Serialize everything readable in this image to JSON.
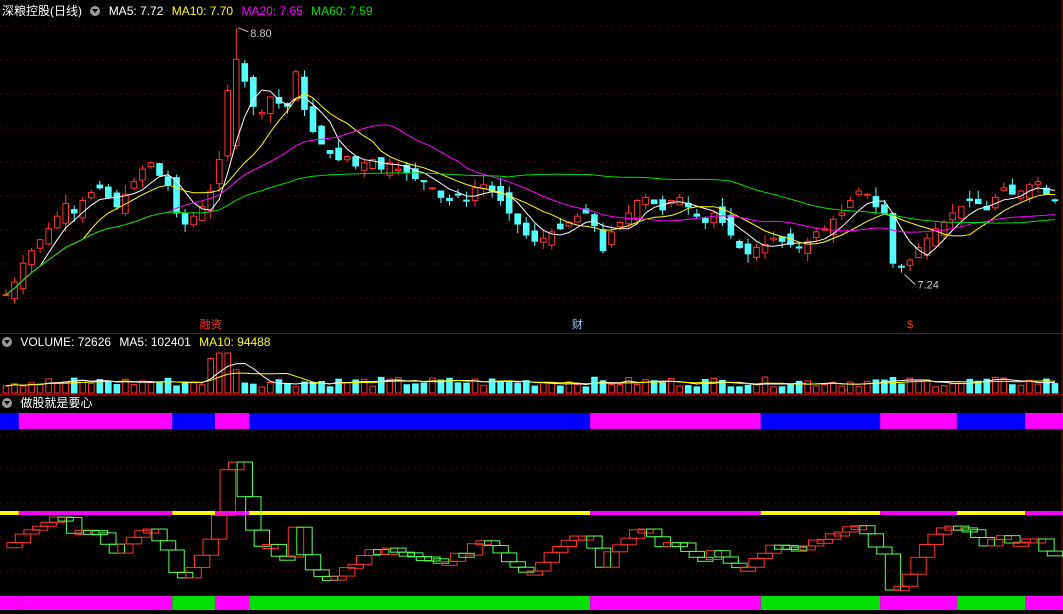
{
  "header": {
    "stock_name": "深粮控股(日线)",
    "ma5": "MA5: 7.72",
    "ma10": "MA10: 7.70",
    "ma20": "MA20: 7.65",
    "ma60": "MA60: 7.59",
    "colors": {
      "ma5": "#ffffff",
      "ma10": "#ffff00",
      "ma20": "#ff00ff",
      "ma60": "#00e000"
    }
  },
  "volume_header": {
    "volume": "VOLUME: 72626",
    "ma5": "MA5: 102401",
    "ma10": "MA10: 94488"
  },
  "indicator_header": {
    "name": "做股就是要心"
  },
  "annotations": {
    "high_label": "8.80",
    "low_label": "7.24",
    "event_1": "融资",
    "event_2": "财",
    "event_3": "$"
  },
  "chart_data": {
    "type": "candlestick",
    "price_range": [
      6.9,
      8.85
    ],
    "high": 8.8,
    "low": 7.24,
    "closes": [
      7.1,
      7.18,
      7.3,
      7.38,
      7.45,
      7.52,
      7.6,
      7.68,
      7.62,
      7.7,
      7.75,
      7.78,
      7.72,
      7.66,
      7.74,
      7.82,
      7.9,
      7.94,
      7.86,
      7.8,
      7.62,
      7.55,
      7.6,
      7.66,
      7.76,
      7.96,
      8.4,
      8.6,
      8.46,
      8.3,
      8.26,
      8.36,
      8.32,
      8.3,
      8.52,
      8.28,
      8.14,
      8.06,
      8.0,
      7.96,
      7.98,
      7.92,
      7.94,
      7.96,
      7.9,
      7.94,
      7.9,
      7.88,
      7.84,
      7.82,
      7.78,
      7.72,
      7.7,
      7.74,
      7.7,
      7.78,
      7.8,
      7.76,
      7.7,
      7.62,
      7.55,
      7.48,
      7.44,
      7.46,
      7.5,
      7.52,
      7.56,
      7.6,
      7.62,
      7.54,
      7.38,
      7.5,
      7.56,
      7.62,
      7.7,
      7.72,
      7.68,
      7.64,
      7.7,
      7.72,
      7.66,
      7.6,
      7.56,
      7.62,
      7.56,
      7.48,
      7.4,
      7.36,
      7.4,
      7.42,
      7.46,
      7.44,
      7.42,
      7.4,
      7.44,
      7.5,
      7.52,
      7.58,
      7.62,
      7.7,
      7.76,
      7.74,
      7.66,
      7.62,
      7.3,
      7.28,
      7.32,
      7.4,
      7.46,
      7.52,
      7.56,
      7.62,
      7.66,
      7.7,
      7.68,
      7.64,
      7.72,
      7.78,
      7.74,
      7.76,
      7.8,
      7.82,
      7.74,
      7.7
    ],
    "ma_periods": [
      5,
      10,
      20,
      60
    ],
    "volume": {
      "last": 72626,
      "ma5": 102401,
      "ma10": 94488
    }
  }
}
